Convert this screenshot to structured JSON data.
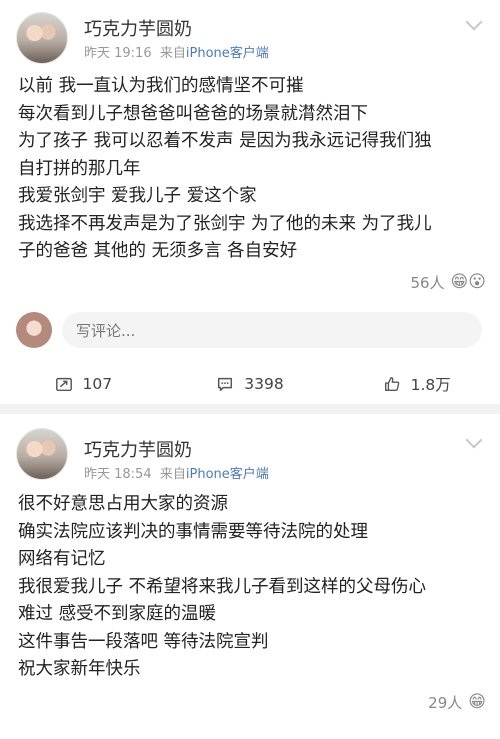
{
  "posts": [
    {
      "author": "巧克力芋圆奶",
      "time": "昨天 19:16",
      "source_prefix": "来自",
      "source": "iPhone客户端",
      "lines": [
        "以前 我一直认为我们的感情坚不可摧",
        "每次看到儿子想爸爸叫爸爸的场景就潸然泪下",
        "为了孩子 我可以忍着不发声 是因为我永远记得我们独",
        "自打拼的那几年",
        "我爱张剑宇 爱我儿子 爱这个家",
        "我选择不再发声是为了张剑宇 为了他的未来 为了我儿",
        "子的爸爸 其他的 无须多言 各自安好"
      ],
      "likes_text": "56人",
      "likes_emoji": "😁😮",
      "comment_placeholder": "写评论...",
      "actions": {
        "repost": "107",
        "comment": "3398",
        "like": "1.8万"
      }
    },
    {
      "author": "巧克力芋圆奶",
      "time": "昨天 18:54",
      "source_prefix": "来自",
      "source": "iPhone客户端",
      "lines": [
        "很不好意思占用大家的资源",
        "确实法院应该判决的事情需要等待法院的处理",
        "网络有记忆",
        "我很爱我儿子 不希望将来我儿子看到这样的父母伤心",
        "难过 感受不到家庭的温暖",
        "这件事告一段落吧 等待法院宣判",
        "祝大家新年快乐"
      ],
      "likes_text": "29人",
      "likes_emoji": "😁"
    }
  ]
}
